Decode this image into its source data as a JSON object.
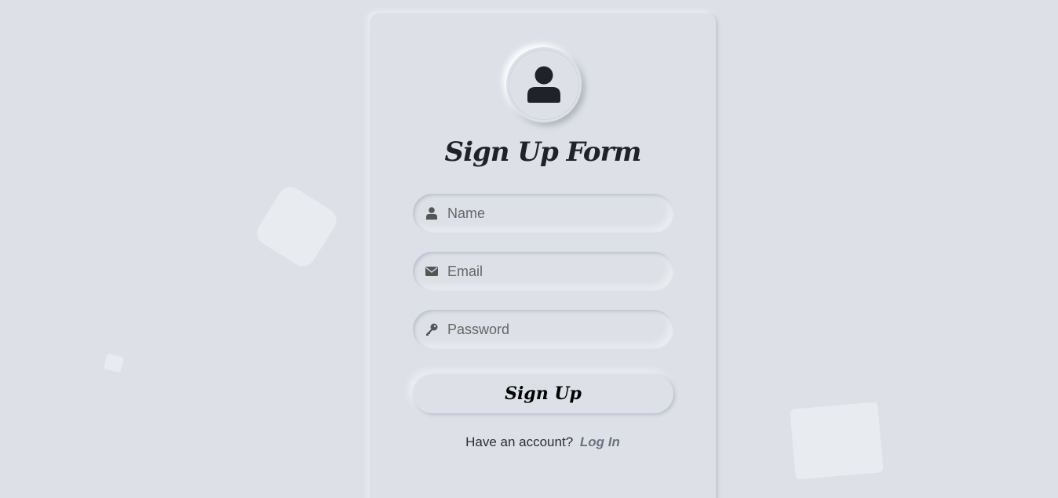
{
  "form": {
    "title": "Sign Up Form",
    "fields": [
      {
        "name": "name",
        "placeholder": "Name",
        "icon": "user-icon"
      },
      {
        "name": "email",
        "placeholder": "Email",
        "icon": "envelope-icon"
      },
      {
        "name": "password",
        "placeholder": "Password",
        "icon": "key-icon"
      }
    ],
    "submit_label": "Sign Up",
    "footer_text": "Have an account?",
    "login_link": "Log In"
  },
  "colors": {
    "background": "#dde1e7",
    "text": "#1f2329",
    "muted": "#6b7280"
  }
}
